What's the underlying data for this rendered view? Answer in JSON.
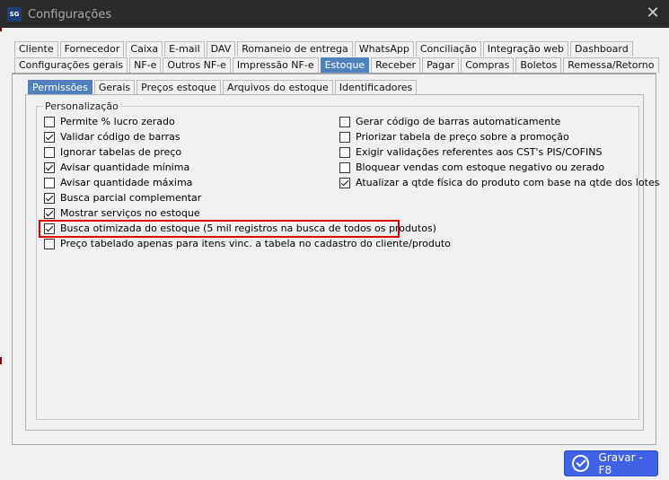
{
  "window": {
    "logo_text": "SG",
    "title": "Configurações",
    "close_glyph": "✕"
  },
  "tabs_row1": [
    "Cliente",
    "Fornecedor",
    "Caixa",
    "E-mail",
    "DAV",
    "Romaneio de entrega",
    "WhatsApp",
    "Conciliação",
    "Integração web",
    "Dashboard"
  ],
  "tabs_row2": [
    "Configurações gerais",
    "NF-e",
    "Outros NF-e",
    "Impressão NF-e",
    "Estoque",
    "Receber",
    "Pagar",
    "Compras",
    "Boletos",
    "Remessa/Retorno"
  ],
  "tabs_row2_active": "Estoque",
  "subtabs": [
    "Permissões",
    "Gerais",
    "Preços estoque",
    "Arquivos do estoque",
    "Identificadores"
  ],
  "subtabs_active": "Permissões",
  "group_title": "Personalização",
  "options_left": [
    {
      "label": "Permite % lucro zerado",
      "checked": false
    },
    {
      "label": "Validar código de barras",
      "checked": true
    },
    {
      "label": "Ignorar tabelas de preço",
      "checked": false
    },
    {
      "label": "Avisar quantidade mínima",
      "checked": true
    },
    {
      "label": "Avisar quantidade máxima",
      "checked": false
    },
    {
      "label": "Busca parcial complementar",
      "checked": true
    },
    {
      "label": "Mostrar serviços no estoque",
      "checked": true
    },
    {
      "label": "Busca otimizada do estoque (5 mil registros na busca de todos os produtos)",
      "checked": true,
      "highlighted": true
    },
    {
      "label": "Preço tabelado apenas para itens vinc. a tabela no cadastro do cliente/produto",
      "checked": false
    }
  ],
  "options_right": [
    {
      "label": "Gerar código de barras automaticamente",
      "checked": false
    },
    {
      "label": "Priorizar tabela de preço sobre a promoção",
      "checked": false
    },
    {
      "label": "Exigir validações referentes aos CST's PIS/COFINS",
      "checked": false
    },
    {
      "label": "Bloquear vendas com estoque negativo ou zerado",
      "checked": false
    },
    {
      "label": "Atualizar a qtde física do produto com base na qtde dos lotes",
      "checked": true
    }
  ],
  "save_button": {
    "label": "Gravar - F8",
    "icon": "check-circle-icon"
  },
  "colors": {
    "titlebar": "#2b2b2b",
    "active_tab": "#4f81bd",
    "highlight": "#e00000",
    "save_button": "#3f62e6"
  }
}
